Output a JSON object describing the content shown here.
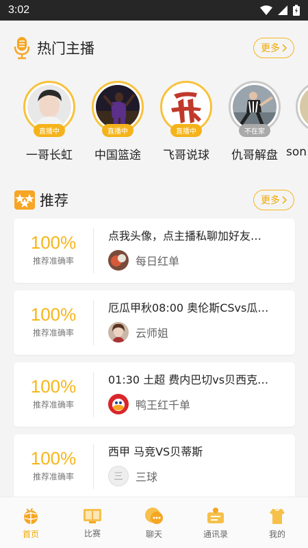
{
  "status_bar": {
    "time": "3:02"
  },
  "hot_anchors": {
    "title": "热门主播",
    "more_label": "更多",
    "items": [
      {
        "name": "一哥长虹",
        "status": "直播中",
        "icon": "anchor-portrait"
      },
      {
        "name": "中国篮途",
        "status": "直播中",
        "icon": "basketball-player"
      },
      {
        "name": "飞哥说球",
        "status": "直播中",
        "icon": "calligraphy-fei"
      },
      {
        "name": "仇哥解盘",
        "status": "不在家",
        "icon": "soccer-kick"
      },
      {
        "name": "son",
        "status": "",
        "icon": "partial-avatar"
      }
    ]
  },
  "recommend": {
    "title": "推荐",
    "more_label": "更多",
    "items": [
      {
        "rate": "100%",
        "rate_label": "推荐准确率",
        "title": "点我头像，点主播私聊加好友…",
        "author": "每日红单"
      },
      {
        "rate": "100%",
        "rate_label": "推荐准确率",
        "title": "厄瓜甲秋08:00 奥伦斯CSvs瓜…",
        "author": "云师姐"
      },
      {
        "rate": "100%",
        "rate_label": "推荐准确率",
        "title": "01:30 土超 费内巴切vs贝西克…",
        "author": "鸭王红千单"
      },
      {
        "rate": "100%",
        "rate_label": "推荐准确率",
        "title": "西甲 马竞VS贝蒂斯",
        "author": "三球",
        "author_avatar_text": "三"
      }
    ]
  },
  "tab_bar": {
    "items": [
      {
        "label": "首页",
        "icon": "home-icon",
        "active": true
      },
      {
        "label": "比赛",
        "icon": "match-icon"
      },
      {
        "label": "聊天",
        "icon": "chat-icon"
      },
      {
        "label": "通讯录",
        "icon": "contacts-icon"
      },
      {
        "label": "我的",
        "icon": "profile-icon"
      }
    ]
  },
  "colors": {
    "accent": "#f6b51a",
    "status_bar": "#262626",
    "offline": "#a9a9a9"
  }
}
